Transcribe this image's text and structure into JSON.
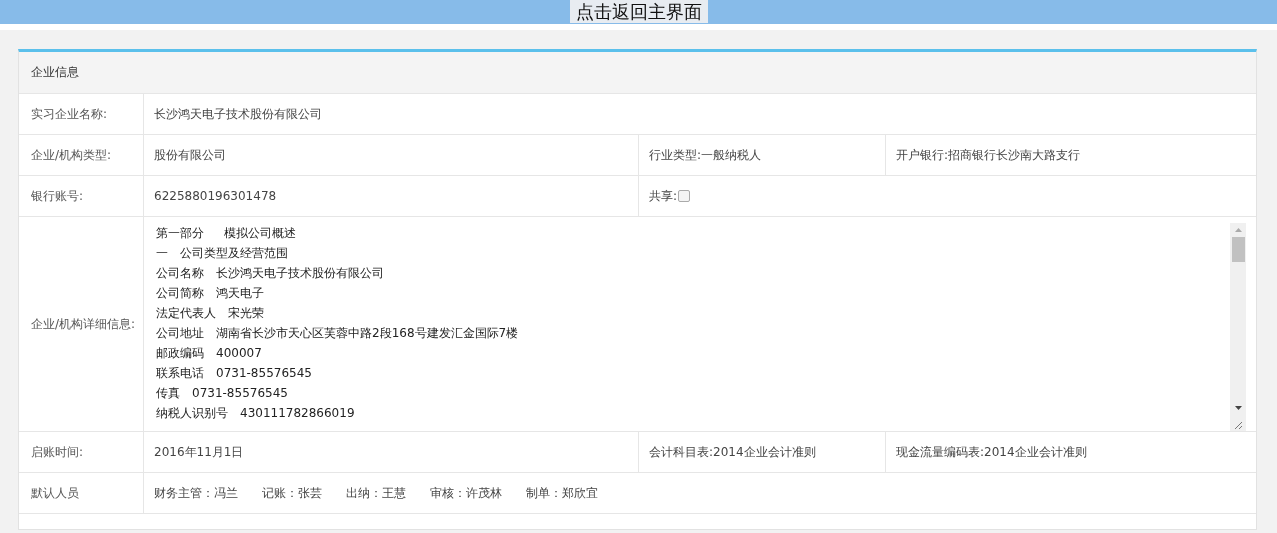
{
  "top_bar": {
    "back_button": "点击返回主界面"
  },
  "panel": {
    "title": "企业信息",
    "rows": [
      {
        "kind": "single",
        "label": "实习企业名称:",
        "value": "长沙鸿天电子技术股份有限公司"
      },
      {
        "kind": "triple",
        "label": "企业/机构类型:",
        "value": "股份有限公司",
        "column_2": "行业类型:一般纳税人",
        "column_3": "开户银行:招商银行长沙南大路支行"
      },
      {
        "kind": "share",
        "label": "银行账号:",
        "value": "6225880196301478",
        "share_label": "共享:",
        "shared": false
      },
      {
        "kind": "details",
        "label": "企业/机构详细信息:",
        "lines": [
          "第一部分　  模拟公司概述",
          "一　公司类型及经营范围",
          "公司名称　长沙鸿天电子技术股份有限公司",
          "公司简称　鸿天电子",
          "法定代表人　宋光荣",
          "公司地址　湖南省长沙市天心区芙蓉中路2段168号建发汇金国际7楼",
          "邮政编码　400007",
          "联系电话　0731-85576545",
          "传真　0731-85576545",
          "纳税人识别号　430111782866019"
        ]
      },
      {
        "kind": "triple",
        "label": "启账时间:",
        "value": "2016年11月1日",
        "column_2": "会计科目表:2014企业会计准则",
        "column_3": "现金流量编码表:2014企业会计准则"
      },
      {
        "kind": "people",
        "label": "默认人员",
        "people": [
          "财务主管：冯兰",
          "记账：张芸",
          "出纳：王慧",
          "审核：许茂林",
          "制单：郑欣宜"
        ]
      }
    ]
  }
}
